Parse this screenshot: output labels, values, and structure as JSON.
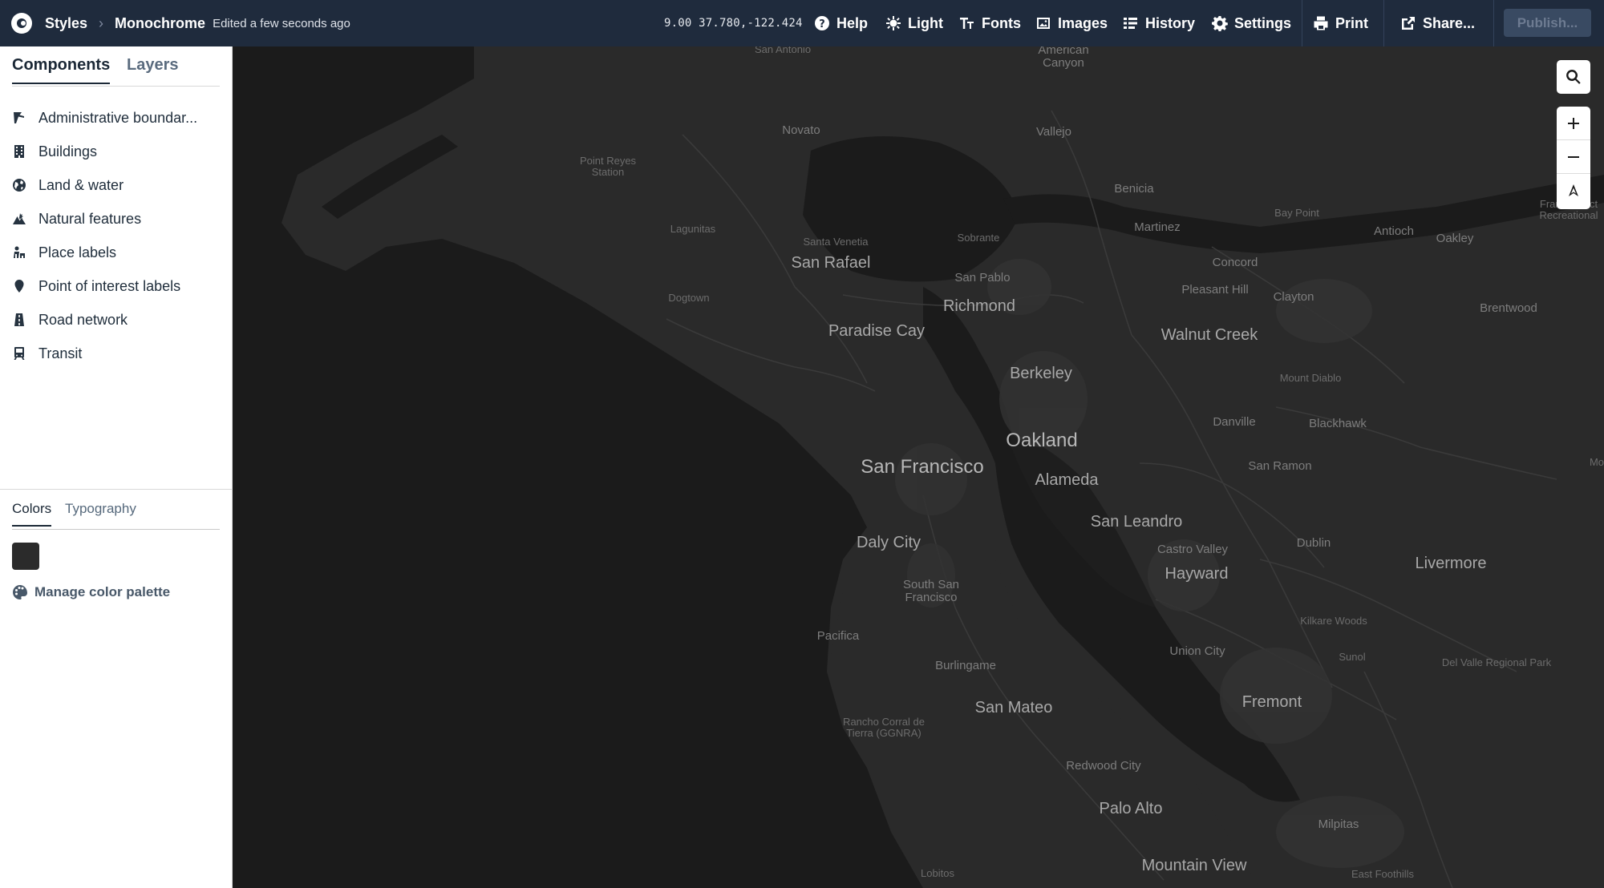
{
  "header": {
    "root_label": "Styles",
    "style_name": "Monochrome",
    "edited_text": "Edited a few seconds ago",
    "coordinates": "9.00 37.780,-122.424",
    "buttons": {
      "help": "Help",
      "light": "Light",
      "fonts": "Fonts",
      "images": "Images",
      "history": "History",
      "settings": "Settings",
      "print": "Print",
      "share": "Share...",
      "publish": "Publish..."
    }
  },
  "sidebar": {
    "tabs": {
      "components": "Components",
      "layers": "Layers"
    },
    "components": [
      {
        "label": "Administrative boundar...",
        "icon": "flag-icon"
      },
      {
        "label": "Buildings",
        "icon": "building-icon"
      },
      {
        "label": "Land & water",
        "icon": "globe-icon"
      },
      {
        "label": "Natural features",
        "icon": "mountain-icon"
      },
      {
        "label": "Place labels",
        "icon": "place-label-icon"
      },
      {
        "label": "Point of interest labels",
        "icon": "pin-icon"
      },
      {
        "label": "Road network",
        "icon": "road-icon"
      },
      {
        "label": "Transit",
        "icon": "train-icon"
      }
    ],
    "lower_tabs": {
      "colors": "Colors",
      "typography": "Typography"
    },
    "swatch_color": "#2b2b2b",
    "manage_palette": "Manage color palette"
  },
  "map": {
    "background_color": "#1b1b1b",
    "land_color": "#2a2a2a",
    "water_color": "#1b1b1b",
    "labels": {
      "san_antonio": "San Antonio",
      "american_canyon": "American\nCanyon",
      "novato": "Novato",
      "vallejo": "Vallejo",
      "point_reyes_station": "Point Reyes\nStation",
      "benicia": "Benicia",
      "bay_point": "Bay Point",
      "martinez": "Martinez",
      "antioch": "Antioch",
      "oakley": "Oakley",
      "franks_tract": "Franks Tract\nRecreational",
      "lagunitas": "Lagunitas",
      "santa_venetia": "Santa Venetia",
      "sobrante": "Sobrante",
      "san_rafael": "San Rafael",
      "concord": "Concord",
      "san_pablo": "San Pablo",
      "pleasant_hill": "Pleasant Hill",
      "clayton": "Clayton",
      "dogtown": "Dogtown",
      "richmond": "Richmond",
      "brentwood": "Brentwood",
      "paradise_cay": "Paradise Cay",
      "walnut_creek": "Walnut Creek",
      "berkeley": "Berkeley",
      "mount_diablo": "Mount Diablo",
      "danville": "Danville",
      "blackhawk": "Blackhawk",
      "oakland": "Oakland",
      "san_francisco": "San Francisco",
      "san_ramon": "San Ramon",
      "alameda": "Alameda",
      "mo": "Mo",
      "san_leandro": "San Leandro",
      "daly_city": "Daly City",
      "dublin": "Dublin",
      "castro_valley": "Castro Valley",
      "livermore": "Livermore",
      "hayward": "Hayward",
      "south_san_francisco": "South San\nFrancisco",
      "kilkare_woods": "Kilkare Woods",
      "pacifica": "Pacifica",
      "union_city": "Union City",
      "sunol": "Sunol",
      "del_valle": "Del Valle Regional Park",
      "burlingame": "Burlingame",
      "fremont": "Fremont",
      "san_mateo": "San Mateo",
      "rancho_corral": "Rancho Corral de\nTierra (GGNRA)",
      "redwood_city": "Redwood City",
      "palo_alto": "Palo Alto",
      "milpitas": "Milpitas",
      "mountain_view": "Mountain View",
      "lobitos": "Lobitos",
      "east_foothills": "East Foothills"
    }
  }
}
